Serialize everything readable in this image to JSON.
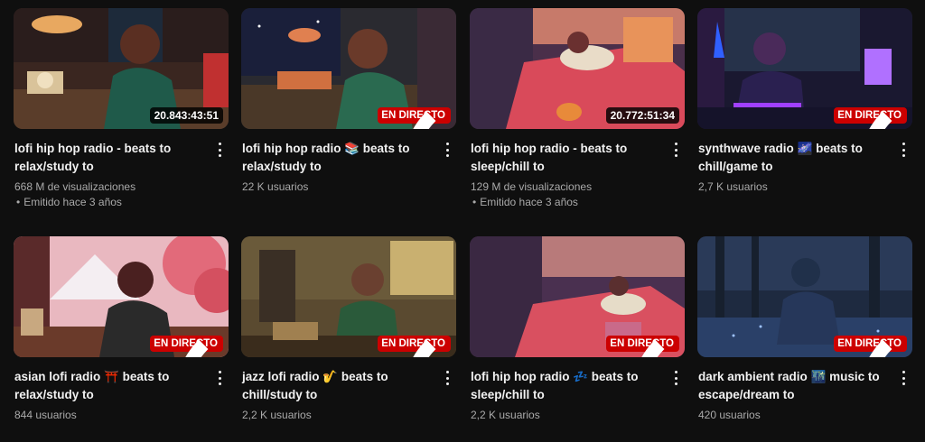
{
  "videos": [
    {
      "title": "lofi hip hop radio - beats to relax/study to",
      "badge": "20.843:43:51",
      "views": "668 M de visualizaciones",
      "date": "Emitido hace 3 años"
    },
    {
      "title": "lofi hip hop radio 📚 beats to relax/study to",
      "badge": "EN DIRECTO",
      "views": "22 K usuarios",
      "date": ""
    },
    {
      "title": "lofi hip hop radio - beats to sleep/chill to",
      "badge": "20.772:51:34",
      "views": "129 M de visualizaciones",
      "date": "Emitido hace 3 años"
    },
    {
      "title": "synthwave radio 🌌 beats to chill/game to",
      "badge": "EN DIRECTO",
      "views": "2,7 K usuarios",
      "date": ""
    },
    {
      "title": "asian lofi radio ⛩️ beats to relax/study to",
      "badge": "EN DIRECTO",
      "views": "844 usuarios",
      "date": ""
    },
    {
      "title": "jazz lofi radio 🎷 beats to chill/study to",
      "badge": "EN DIRECTO",
      "views": "2,2 K usuarios",
      "date": ""
    },
    {
      "title": "lofi hip hop radio 💤 beats to sleep/chill to",
      "badge": "EN DIRECTO",
      "views": "2,2 K usuarios",
      "date": ""
    },
    {
      "title": "dark ambient radio 🌃 music to escape/dream to",
      "badge": "EN DIRECTO",
      "views": "420 usuarios",
      "date": ""
    }
  ],
  "colors": {
    "live_badge": "#cc0000",
    "background": "#0f0f0f",
    "secondary_text": "#aaaaaa"
  }
}
